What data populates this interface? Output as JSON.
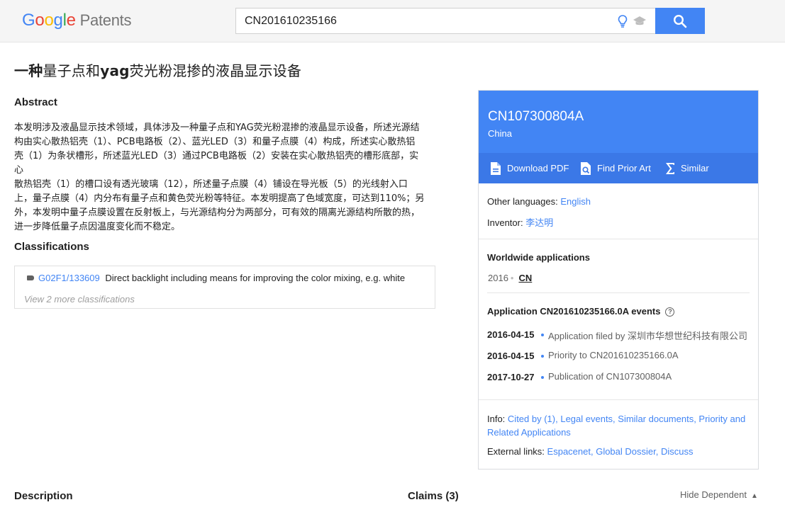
{
  "header": {
    "logo_google": "Google",
    "logo_patents": "Patents",
    "search_value": "CN201610235166"
  },
  "patent": {
    "title_bold_1": "一种",
    "title_part_2": "量子点和",
    "title_bold_3": "yag",
    "title_part_4": "荧光粉混掺的液晶显示设备"
  },
  "abstract": {
    "heading": "Abstract",
    "lines": [
      "本发明涉及液晶显示技术领域，具体涉及一种量子点和YAG荧光粉混掺的液晶显示设备，所述光源结",
      "构由实心散热铝壳（1）、PCB电路板（2）、蓝光LED（3）和量子点膜（4）构成，所述实心散热铝",
      "壳（1）为条状槽形，所述蓝光LED（3）通过PCB电路板（2）安装在实心散热铝壳的槽形底部，实心",
      "散热铝壳（1）的槽口设有透光玻璃（12），所述量子点膜（4）铺设在导光板（5）的光线射入口",
      "上，量子点膜（4）内分布有量子点和黄色荧光粉等特征。本发明提高了色域宽度，可达到110%；另",
      "外，本发明中量子点膜设置在反射板上，与光源结构分为两部分，可有效的隔离光源结构所散的热，",
      "进一步降低量子点因温度变化而不稳定。"
    ]
  },
  "classifications": {
    "heading": "Classifications",
    "code": "G02F1/133609",
    "description": "Direct backlight including means for improving the color mixing, e.g. white",
    "view_more": "View 2 more classifications"
  },
  "description": {
    "heading": "Description"
  },
  "claims": {
    "heading": "Claims (3)",
    "hide_dependent": "Hide Dependent"
  },
  "card": {
    "publication_number": "CN107300804A",
    "country": "China",
    "actions": {
      "download_pdf": "Download PDF",
      "find_prior_art": "Find Prior Art",
      "similar": "Similar"
    },
    "other_languages_label": "Other languages: ",
    "other_languages_value": "English",
    "inventor_label": "Inventor: ",
    "inventor_value": "李达明",
    "worldwide_heading": "Worldwide applications",
    "worldwide_year": "2016",
    "worldwide_country": "CN",
    "application_heading": "Application CN201610235166.0A events",
    "events": [
      {
        "date": "2016-04-15",
        "text": "Application filed by 深圳市华想世纪科技有限公司"
      },
      {
        "date": "2016-04-15",
        "text": "Priority to CN201610235166.0A"
      },
      {
        "date": "2017-10-27",
        "text": "Publication of CN107300804A"
      }
    ],
    "info_label": "Info: ",
    "info_links": "Cited by (1), Legal events, Similar documents, Priority and Related Applications",
    "external_label": "External links: ",
    "external_links": "Espacenet, Global Dossier, Discuss"
  },
  "colors": {
    "accent": "#4285f4",
    "accent_dark": "#3b78e7"
  },
  "icons": [
    "bulb-icon",
    "scholar-hat-icon",
    "search-icon",
    "pdf-icon",
    "prior-art-icon",
    "sigma-icon",
    "tag-icon",
    "help-icon",
    "chevron-up-icon"
  ]
}
